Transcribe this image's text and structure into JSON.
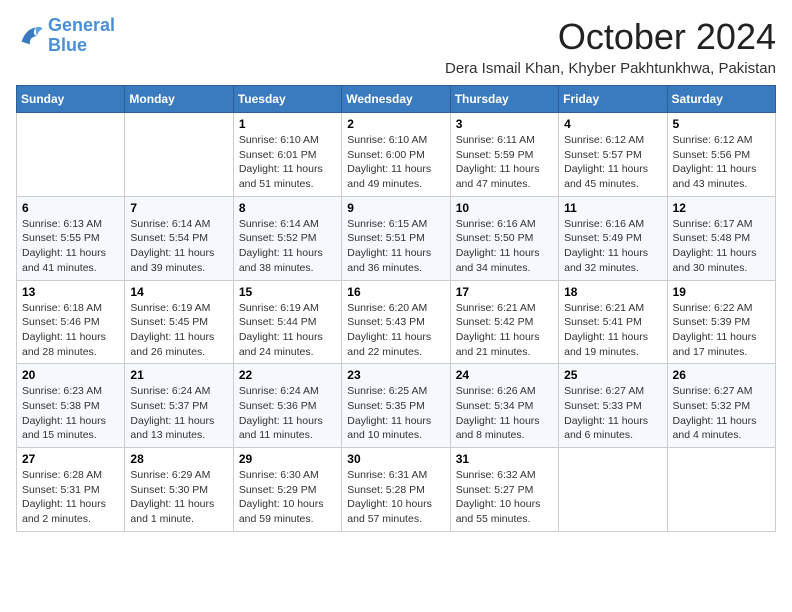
{
  "header": {
    "logo_line1": "General",
    "logo_line2": "Blue",
    "month_title": "October 2024",
    "subtitle": "Dera Ismail Khan, Khyber Pakhtunkhwa, Pakistan"
  },
  "weekdays": [
    "Sunday",
    "Monday",
    "Tuesday",
    "Wednesday",
    "Thursday",
    "Friday",
    "Saturday"
  ],
  "weeks": [
    [
      {
        "day": "",
        "info": ""
      },
      {
        "day": "",
        "info": ""
      },
      {
        "day": "1",
        "info": "Sunrise: 6:10 AM\nSunset: 6:01 PM\nDaylight: 11 hours and 51 minutes."
      },
      {
        "day": "2",
        "info": "Sunrise: 6:10 AM\nSunset: 6:00 PM\nDaylight: 11 hours and 49 minutes."
      },
      {
        "day": "3",
        "info": "Sunrise: 6:11 AM\nSunset: 5:59 PM\nDaylight: 11 hours and 47 minutes."
      },
      {
        "day": "4",
        "info": "Sunrise: 6:12 AM\nSunset: 5:57 PM\nDaylight: 11 hours and 45 minutes."
      },
      {
        "day": "5",
        "info": "Sunrise: 6:12 AM\nSunset: 5:56 PM\nDaylight: 11 hours and 43 minutes."
      }
    ],
    [
      {
        "day": "6",
        "info": "Sunrise: 6:13 AM\nSunset: 5:55 PM\nDaylight: 11 hours and 41 minutes."
      },
      {
        "day": "7",
        "info": "Sunrise: 6:14 AM\nSunset: 5:54 PM\nDaylight: 11 hours and 39 minutes."
      },
      {
        "day": "8",
        "info": "Sunrise: 6:14 AM\nSunset: 5:52 PM\nDaylight: 11 hours and 38 minutes."
      },
      {
        "day": "9",
        "info": "Sunrise: 6:15 AM\nSunset: 5:51 PM\nDaylight: 11 hours and 36 minutes."
      },
      {
        "day": "10",
        "info": "Sunrise: 6:16 AM\nSunset: 5:50 PM\nDaylight: 11 hours and 34 minutes."
      },
      {
        "day": "11",
        "info": "Sunrise: 6:16 AM\nSunset: 5:49 PM\nDaylight: 11 hours and 32 minutes."
      },
      {
        "day": "12",
        "info": "Sunrise: 6:17 AM\nSunset: 5:48 PM\nDaylight: 11 hours and 30 minutes."
      }
    ],
    [
      {
        "day": "13",
        "info": "Sunrise: 6:18 AM\nSunset: 5:46 PM\nDaylight: 11 hours and 28 minutes."
      },
      {
        "day": "14",
        "info": "Sunrise: 6:19 AM\nSunset: 5:45 PM\nDaylight: 11 hours and 26 minutes."
      },
      {
        "day": "15",
        "info": "Sunrise: 6:19 AM\nSunset: 5:44 PM\nDaylight: 11 hours and 24 minutes."
      },
      {
        "day": "16",
        "info": "Sunrise: 6:20 AM\nSunset: 5:43 PM\nDaylight: 11 hours and 22 minutes."
      },
      {
        "day": "17",
        "info": "Sunrise: 6:21 AM\nSunset: 5:42 PM\nDaylight: 11 hours and 21 minutes."
      },
      {
        "day": "18",
        "info": "Sunrise: 6:21 AM\nSunset: 5:41 PM\nDaylight: 11 hours and 19 minutes."
      },
      {
        "day": "19",
        "info": "Sunrise: 6:22 AM\nSunset: 5:39 PM\nDaylight: 11 hours and 17 minutes."
      }
    ],
    [
      {
        "day": "20",
        "info": "Sunrise: 6:23 AM\nSunset: 5:38 PM\nDaylight: 11 hours and 15 minutes."
      },
      {
        "day": "21",
        "info": "Sunrise: 6:24 AM\nSunset: 5:37 PM\nDaylight: 11 hours and 13 minutes."
      },
      {
        "day": "22",
        "info": "Sunrise: 6:24 AM\nSunset: 5:36 PM\nDaylight: 11 hours and 11 minutes."
      },
      {
        "day": "23",
        "info": "Sunrise: 6:25 AM\nSunset: 5:35 PM\nDaylight: 11 hours and 10 minutes."
      },
      {
        "day": "24",
        "info": "Sunrise: 6:26 AM\nSunset: 5:34 PM\nDaylight: 11 hours and 8 minutes."
      },
      {
        "day": "25",
        "info": "Sunrise: 6:27 AM\nSunset: 5:33 PM\nDaylight: 11 hours and 6 minutes."
      },
      {
        "day": "26",
        "info": "Sunrise: 6:27 AM\nSunset: 5:32 PM\nDaylight: 11 hours and 4 minutes."
      }
    ],
    [
      {
        "day": "27",
        "info": "Sunrise: 6:28 AM\nSunset: 5:31 PM\nDaylight: 11 hours and 2 minutes."
      },
      {
        "day": "28",
        "info": "Sunrise: 6:29 AM\nSunset: 5:30 PM\nDaylight: 11 hours and 1 minute."
      },
      {
        "day": "29",
        "info": "Sunrise: 6:30 AM\nSunset: 5:29 PM\nDaylight: 10 hours and 59 minutes."
      },
      {
        "day": "30",
        "info": "Sunrise: 6:31 AM\nSunset: 5:28 PM\nDaylight: 10 hours and 57 minutes."
      },
      {
        "day": "31",
        "info": "Sunrise: 6:32 AM\nSunset: 5:27 PM\nDaylight: 10 hours and 55 minutes."
      },
      {
        "day": "",
        "info": ""
      },
      {
        "day": "",
        "info": ""
      }
    ]
  ]
}
